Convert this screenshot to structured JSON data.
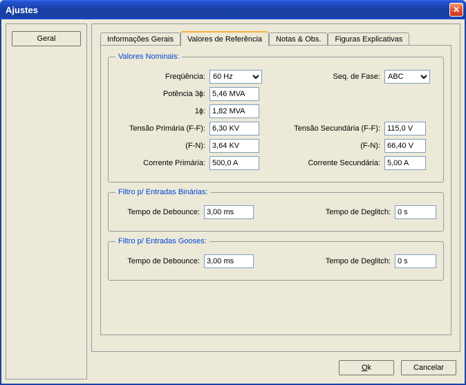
{
  "window": {
    "title": "Ajustes"
  },
  "sidebar": {
    "geral_label": "Geral"
  },
  "tabs": {
    "info": "Informações Gerais",
    "valores": "Valores de Referência",
    "notas": "Notas & Obs.",
    "figuras": "Figuras Explicativas"
  },
  "groups": {
    "nominais": "Valores Nominais:",
    "binarias": "Filtro p/ Entradas Binárias:",
    "gooses": "Filtro p/ Entradas Gooses:"
  },
  "labels": {
    "frequencia": "Freqüência:",
    "seq_fase": "Seq. de Fase:",
    "potencia3": "Potência 3ɸ:",
    "potencia1": "1ɸ:",
    "tensao_prim_ff": "Tensão Primária (F-F):",
    "tensao_sec_ff": "Tensão Secundária (F-F):",
    "fn": "(F-N):",
    "corrente_prim": "Corrente Primária:",
    "corrente_sec": "Corrente Secundária:",
    "tempo_debounce": "Tempo de Debounce:",
    "tempo_deglitch": "Tempo de Deglitch:"
  },
  "values": {
    "frequencia": "60 Hz",
    "seq_fase": "ABC",
    "potencia3": "5,46 MVA",
    "potencia1": "1,82 MVA",
    "tensao_prim_ff": "6,30 KV",
    "tensao_sec_ff": "115,0 V",
    "tensao_prim_fn": "3,64 KV",
    "tensao_sec_fn": "66,40 V",
    "corrente_prim": "500,0 A",
    "corrente_sec": "5,00 A",
    "bin_debounce": "3,00 ms",
    "bin_deglitch": "0 s",
    "goose_debounce": "3,00 ms",
    "goose_deglitch": "0 s"
  },
  "buttons": {
    "ok": "Ok",
    "cancel": "Cancelar"
  }
}
